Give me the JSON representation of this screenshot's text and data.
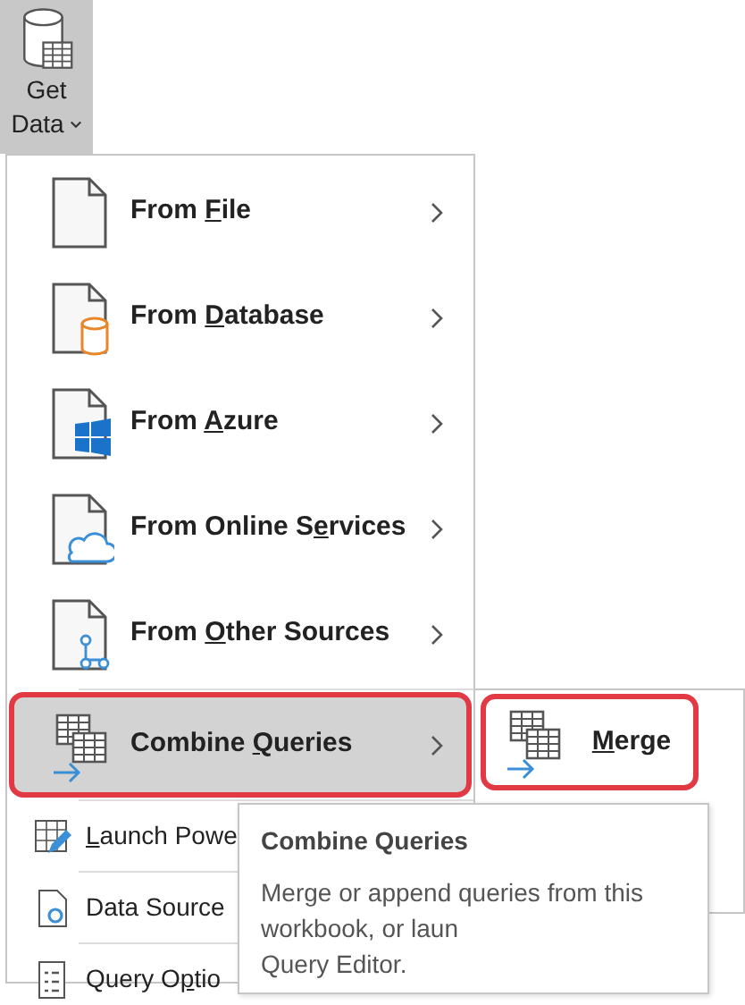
{
  "get_data_button": {
    "label_lines": [
      "Get",
      "Data"
    ],
    "expanded": true
  },
  "menu": {
    "items": [
      {
        "kind": "large",
        "label": {
          "before": "From ",
          "key": "F",
          "after": "ile"
        },
        "has_submenu": true,
        "selected": false,
        "highlighted": false
      },
      {
        "kind": "large",
        "label": {
          "before": "From ",
          "key": "D",
          "after": "atabase"
        },
        "has_submenu": true,
        "selected": false,
        "highlighted": false
      },
      {
        "kind": "large",
        "label": {
          "before": "From ",
          "key": "A",
          "after": "zure"
        },
        "has_submenu": true,
        "selected": false,
        "highlighted": false
      },
      {
        "kind": "large",
        "label": {
          "before": "From Online S",
          "key": "e",
          "after": "rvices"
        },
        "has_submenu": true,
        "selected": false,
        "highlighted": false
      },
      {
        "kind": "large",
        "label": {
          "before": "From ",
          "key": "O",
          "after": "ther Sources"
        },
        "has_submenu": true,
        "selected": false,
        "highlighted": false
      },
      {
        "kind": "large",
        "label": {
          "before": "Combine ",
          "key": "Q",
          "after": "ueries"
        },
        "has_submenu": true,
        "selected": true,
        "highlighted": true
      },
      {
        "kind": "small",
        "label": {
          "key": "L",
          "after": "aunch Powe"
        },
        "selected": false
      },
      {
        "kind": "small",
        "label": {
          "before": "Data Source"
        },
        "selected": false
      },
      {
        "kind": "small",
        "label": {
          "before": "Query O",
          "key": "p",
          "after": "tio"
        },
        "selected": false
      }
    ]
  },
  "submenu": {
    "items": [
      {
        "label": {
          "key": "M",
          "after": "erge"
        },
        "highlighted": true
      }
    ]
  },
  "tooltip": {
    "title": "Combine Queries",
    "body_lines": [
      "Merge or append queries from this workbook, or laun",
      "Query Editor."
    ]
  }
}
